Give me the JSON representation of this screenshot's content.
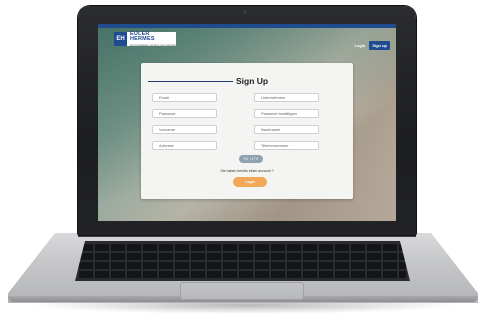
{
  "brand": {
    "mark": "EH",
    "name": "EULER HERMES",
    "tagline": "Our knowledge serving your success"
  },
  "nav": {
    "login_label": "Login",
    "signup_label": "Sign up"
  },
  "form": {
    "title": "Sign Up",
    "fields": {
      "email": "Email",
      "company": "Unternehmen",
      "password": "Passwort",
      "password_confirm": "Passwort bestätigen",
      "firstname": "Vorname",
      "lastname": "Nachname",
      "address": "Adresse",
      "phone": "Telefonnummer"
    },
    "captcha": "9X UT0",
    "account_prompt": "Sie haben bereits einen account ?",
    "submit_label": "Login"
  },
  "colors": {
    "brand_blue": "#1f4b8f",
    "accent_orange": "#f0a857",
    "captcha_bg": "#8fa0b1"
  }
}
